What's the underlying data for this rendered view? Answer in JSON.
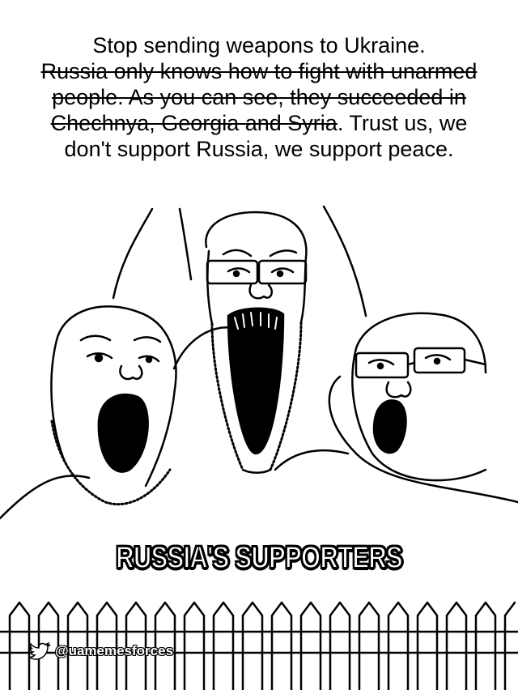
{
  "caption": {
    "line1": "Stop sending weapons to Ukraine.",
    "struck": "Russia only knows how to fight with unarmed people. As you can see, they succeeded in Chechnya, Georgia and Syria",
    "rest": ". Trust us, we don't support Russia, we support peace."
  },
  "label": "RUSSIA'S SUPPORTERS",
  "watermark": {
    "handle": "@uamemesforces",
    "icon": "twitter-bird-icon"
  },
  "colors": {
    "ink": "#000000",
    "paper": "#ffffff"
  }
}
